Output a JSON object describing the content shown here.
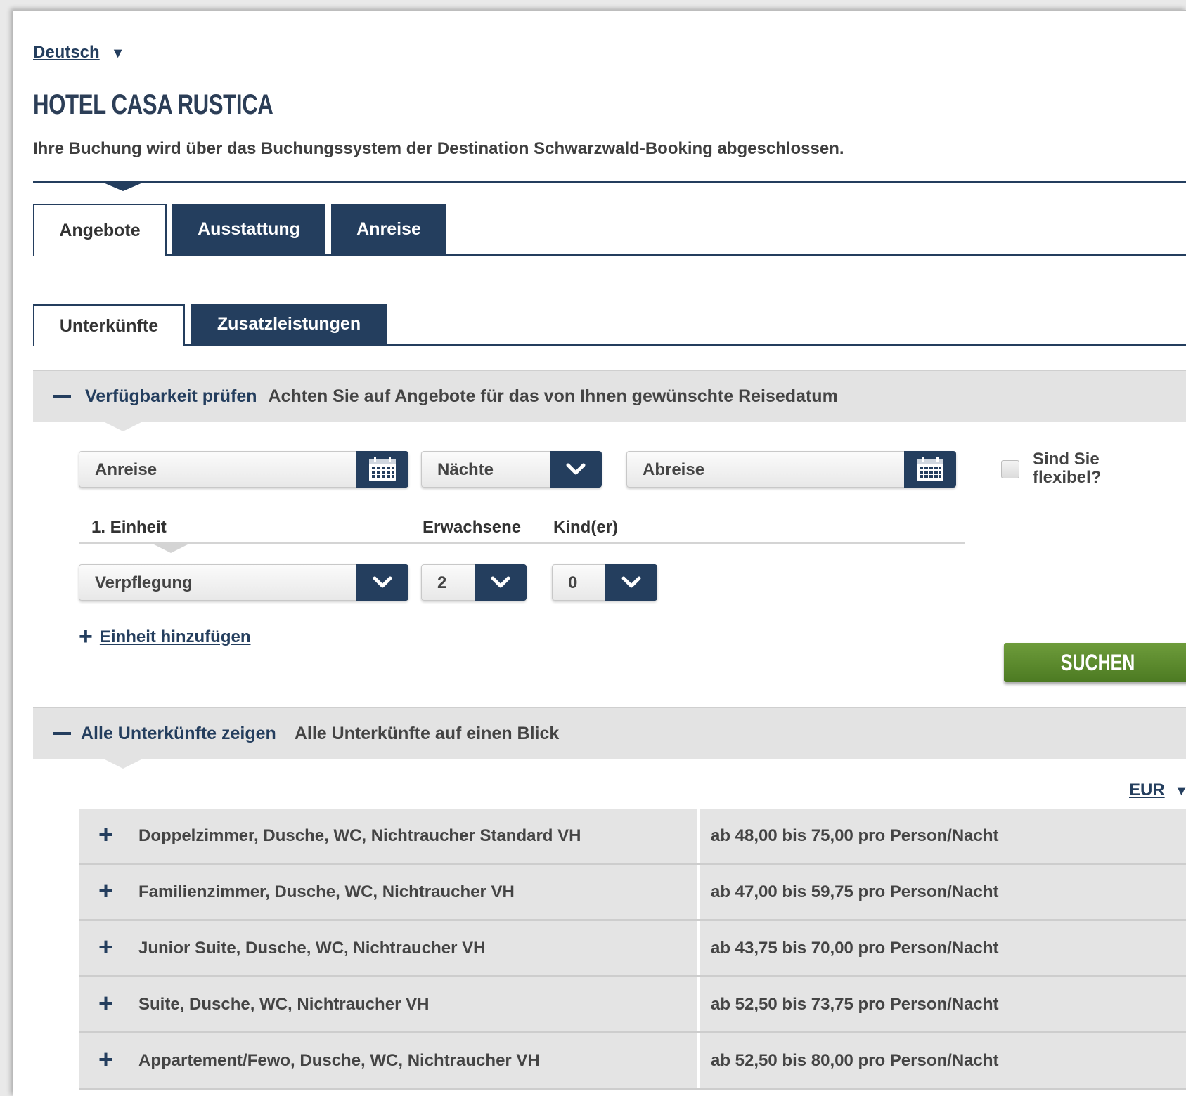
{
  "language": {
    "label": "Deutsch"
  },
  "hotel": {
    "title": "HOTEL CASA RUSTICA",
    "note": "Ihre Buchung wird über das Buchungssystem der Destination Schwarzwald-Booking abgeschlossen."
  },
  "tabs": [
    {
      "label": "Angebote",
      "active": true
    },
    {
      "label": "Ausstattung",
      "active": false
    },
    {
      "label": "Anreise",
      "active": false
    }
  ],
  "subtabs": [
    {
      "label": "Unterkünfte",
      "active": true
    },
    {
      "label": "Zusatzleistungen",
      "active": false
    }
  ],
  "availability": {
    "title": "Verfügbarkeit prüfen",
    "description": "Achten Sie auf Angebote für das von Ihnen gewünschte Reisedatum",
    "arrival_placeholder": "Anreise",
    "nights_value": "Nächte",
    "departure_placeholder": "Abreise",
    "flexible_label_line1": "Sind Sie",
    "flexible_label_line2": "flexibel?",
    "unit_label": "1. Einheit",
    "adults_label": "Erwachsene",
    "children_label": "Kind(er)",
    "board_value": "Verpflegung",
    "adults_value": "2",
    "children_value": "0",
    "add_unit_label": "Einheit hinzufügen",
    "search_label": "SUCHEN"
  },
  "all_units": {
    "title": "Alle Unterkünfte zeigen",
    "description": "Alle Unterkünfte auf einen Blick",
    "currency": "EUR",
    "rooms": [
      {
        "name": "Doppelzimmer, Dusche, WC, Nichtraucher Standard VH",
        "price": "ab 48,00 bis 75,00 pro Person/Nacht"
      },
      {
        "name": "Familienzimmer, Dusche, WC, Nichtraucher VH",
        "price": "ab 47,00 bis 59,75 pro Person/Nacht"
      },
      {
        "name": "Junior Suite, Dusche, WC, Nichtraucher VH",
        "price": "ab 43,75 bis 70,00 pro Person/Nacht"
      },
      {
        "name": "Suite, Dusche, WC, Nichtraucher VH",
        "price": "ab 52,50 bis 73,75 pro Person/Nacht"
      },
      {
        "name": "Appartement/Fewo, Dusche, WC, Nichtraucher VH",
        "price": "ab 52,50 bis 80,00 pro Person/Nacht"
      }
    ]
  },
  "icons": {
    "calendar": "calendar-icon",
    "chevron": "chevron-down-icon",
    "plus": "plus-icon",
    "minus": "minus-icon",
    "caret": "caret-down-icon"
  },
  "colors": {
    "navy": "#243e5e",
    "green_button": "#5a8a2c",
    "panel_grey": "#e3e3e3"
  }
}
